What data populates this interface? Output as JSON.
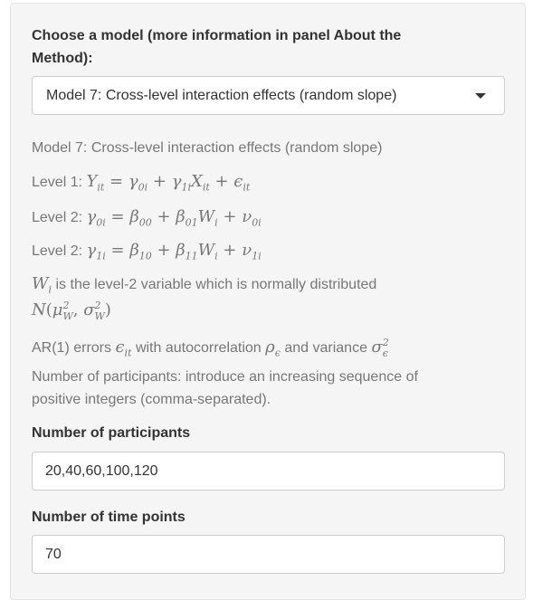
{
  "model_select": {
    "label_line1": "Choose a model (more information in panel About the",
    "label_line2": "Method):",
    "selected": "Model 7: Cross-level interaction effects (random slope)"
  },
  "description": {
    "model_title": "Model 7: Cross-level interaction effects (random slope)",
    "level1_prefix": "Level 1: ",
    "level2_prefix_a": "Level 2: ",
    "level2_prefix_b": "Level 2: ",
    "w_text": " is the level-2 variable which is normally distributed",
    "ar_text_a": "AR(1) errors ",
    "ar_text_b": " with autocorrelation ",
    "ar_text_c": " and variance ",
    "participants_help_line1": "Number of participants: introduce an increasing sequence of",
    "participants_help_line2": "positive integers (comma-separated)."
  },
  "participants_field": {
    "label": "Number of participants",
    "value": "20,40,60,100,120"
  },
  "timepoints_field": {
    "label": "Number of time points",
    "value": "70"
  }
}
